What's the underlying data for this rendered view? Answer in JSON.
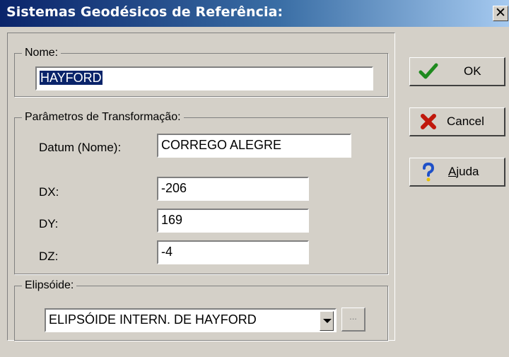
{
  "window": {
    "title": "Sistemas Geodésicos de Referência:",
    "close_glyph": "✕"
  },
  "nome": {
    "legend": "Nome:",
    "value": "HAYFORD"
  },
  "transform": {
    "legend": "Parâmetros de Transformação:",
    "datum_label": "Datum (Nome):",
    "datum_value": "CORREGO ALEGRE",
    "dx_label": "DX:",
    "dx_value": "-206",
    "dy_label": "DY:",
    "dy_value": "169",
    "dz_label": "DZ:",
    "dz_value": "-4"
  },
  "elipsoide": {
    "legend": "Elipsóide:",
    "selected": "ELIPSÓIDE INTERN. DE HAYFORD",
    "ellipsis": "..."
  },
  "buttons": {
    "ok": "OK",
    "cancel": "Cancel",
    "help_mnemonic": "A",
    "help_rest": "juda"
  },
  "icons": {
    "ok": "checkmark-icon",
    "cancel": "x-icon",
    "help": "question-mark-icon"
  },
  "colors": {
    "check": "#1e8a1e",
    "cross": "#c0180c",
    "question_top": "#1e50c8",
    "question_dot": "#e8c000"
  }
}
